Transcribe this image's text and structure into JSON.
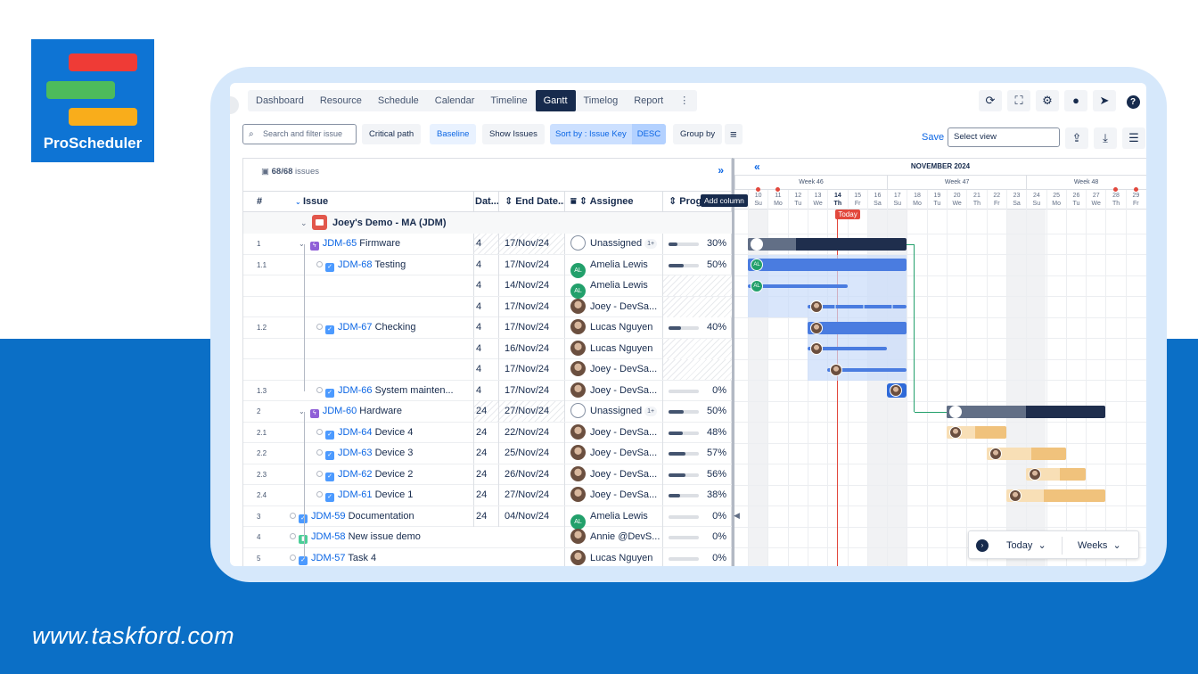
{
  "brand": {
    "logo_text": "ProScheduler",
    "url": "www.taskford.com"
  },
  "nav": {
    "tabs": [
      "Dashboard",
      "Resource",
      "Schedule",
      "Calendar",
      "Timeline",
      "Gantt",
      "Timelog",
      "Report"
    ],
    "active": "Gantt",
    "more": "⋮"
  },
  "top_icons": [
    "refresh-icon",
    "fullscreen-icon",
    "gear-icon",
    "bulb-icon",
    "rocket-icon",
    "help-icon"
  ],
  "toolbar": {
    "search_placeholder": "Search and filter issue",
    "critical_path": "Critical path",
    "baseline": "Baseline",
    "show_issues": "Show Issues",
    "sort_label": "Sort by : Issue Key",
    "sort_dir": "DESC",
    "group_by": "Group by",
    "save": "Save",
    "select_view_placeholder": "Select view"
  },
  "grid": {
    "issues_count": "68/68",
    "issues_label": "issues",
    "headers": {
      "num": "#",
      "issue": "Issue",
      "start": "Dat...",
      "end": "End Date...",
      "assignee": "Assignee",
      "progress": "Progr"
    },
    "add_column_tooltip": "Add column",
    "group_title": "Joey's Demo - MA  (JDM)",
    "rows": [
      {
        "num": "1",
        "indent": 0,
        "type": "epic",
        "key": "JDM-65",
        "title": "Firmware",
        "start": "4",
        "end": "17/Nov/24",
        "assignee": "Unassigned",
        "av": "un",
        "plus": "1+",
        "progress": 30,
        "pct": "30%",
        "chev": true,
        "hatch": true
      },
      {
        "num": "1.1",
        "indent": 1,
        "type": "task",
        "key": "JDM-68",
        "title": "Testing",
        "start": "4",
        "end": "17/Nov/24",
        "assignee": "Amelia Lewis",
        "av": "al",
        "progress": 50,
        "pct": "50%"
      },
      {
        "num": "",
        "indent": 2,
        "type": "",
        "key": "",
        "title": "",
        "start": "4",
        "end": "14/Nov/24",
        "assignee": "Amelia Lewis",
        "av": "al",
        "progress": null,
        "pct": "",
        "hatchprog": true
      },
      {
        "num": "",
        "indent": 2,
        "type": "",
        "key": "",
        "title": "",
        "start": "4",
        "end": "17/Nov/24",
        "assignee": "Joey - DevSa...",
        "av": "ph",
        "progress": null,
        "pct": "",
        "hatchprog": true
      },
      {
        "num": "1.2",
        "indent": 1,
        "type": "task",
        "key": "JDM-67",
        "title": "Checking",
        "start": "4",
        "end": "17/Nov/24",
        "assignee": "Lucas Nguyen",
        "av": "ph",
        "progress": 40,
        "pct": "40%"
      },
      {
        "num": "",
        "indent": 2,
        "type": "",
        "key": "",
        "title": "",
        "start": "4",
        "end": "16/Nov/24",
        "assignee": "Lucas Nguyen",
        "av": "ph",
        "progress": null,
        "pct": "",
        "hatchprog": true
      },
      {
        "num": "",
        "indent": 2,
        "type": "",
        "key": "",
        "title": "",
        "start": "4",
        "end": "17/Nov/24",
        "assignee": "Joey - DevSa...",
        "av": "ph",
        "progress": null,
        "pct": "",
        "hatchprog": true
      },
      {
        "num": "1.3",
        "indent": 1,
        "type": "task",
        "key": "JDM-66",
        "title": "System mainten...",
        "start": "4",
        "end": "17/Nov/24",
        "assignee": "Joey - DevSa...",
        "av": "ph",
        "progress": 0,
        "pct": "0%"
      },
      {
        "num": "2",
        "indent": 0,
        "type": "epic",
        "key": "JDM-60",
        "title": "Hardware",
        "start": "24",
        "end": "27/Nov/24",
        "assignee": "Unassigned",
        "av": "un",
        "plus": "1+",
        "progress": 50,
        "pct": "50%",
        "chev": true,
        "hatch": true
      },
      {
        "num": "2.1",
        "indent": 1,
        "type": "task",
        "key": "JDM-64",
        "title": "Device 4",
        "start": "24",
        "end": "22/Nov/24",
        "assignee": "Joey - DevSa...",
        "av": "ph",
        "progress": 48,
        "pct": "48%"
      },
      {
        "num": "2.2",
        "indent": 1,
        "type": "task",
        "key": "JDM-63",
        "title": "Device 3",
        "start": "24",
        "end": "25/Nov/24",
        "assignee": "Joey - DevSa...",
        "av": "ph",
        "progress": 57,
        "pct": "57%"
      },
      {
        "num": "2.3",
        "indent": 1,
        "type": "task",
        "key": "JDM-62",
        "title": "Device 2",
        "start": "24",
        "end": "26/Nov/24",
        "assignee": "Joey - DevSa...",
        "av": "ph",
        "progress": 56,
        "pct": "56%"
      },
      {
        "num": "2.4",
        "indent": 1,
        "type": "task",
        "key": "JDM-61",
        "title": "Device 1",
        "start": "24",
        "end": "27/Nov/24",
        "assignee": "Joey - DevSa...",
        "av": "ph",
        "progress": 38,
        "pct": "38%"
      },
      {
        "num": "3",
        "indent": 0,
        "type": "task",
        "key": "JDM-59",
        "title": "Documentation",
        "start": "24",
        "end": "04/Nov/24",
        "assignee": "Amelia Lewis",
        "av": "al",
        "progress": 0,
        "pct": "0%"
      },
      {
        "num": "4",
        "indent": 0,
        "type": "story",
        "key": "JDM-58",
        "title": "New issue demo",
        "start": "",
        "end": "",
        "assignee": "Annie @DevS...",
        "av": "ph",
        "progress": 0,
        "pct": "0%"
      },
      {
        "num": "5",
        "indent": 0,
        "type": "task",
        "key": "JDM-57",
        "title": "Task 4",
        "start": "",
        "end": "",
        "assignee": "Lucas Nguyen",
        "av": "ph",
        "progress": 0,
        "pct": "0%"
      }
    ]
  },
  "gantt": {
    "month": "NOVEMBER 2024",
    "nav_left": "«",
    "weeks": [
      {
        "label": "Week 46"
      },
      {
        "label": "Week 47"
      },
      {
        "label": "Week 48"
      }
    ],
    "days": [
      {
        "d": "10",
        "w": "Su",
        "holiday": true
      },
      {
        "d": "11",
        "w": "Mo",
        "holiday": true
      },
      {
        "d": "12",
        "w": "Tu"
      },
      {
        "d": "13",
        "w": "We"
      },
      {
        "d": "14",
        "w": "Th",
        "today": true
      },
      {
        "d": "15",
        "w": "Fr"
      },
      {
        "d": "16",
        "w": "Sa"
      },
      {
        "d": "17",
        "w": "Su"
      },
      {
        "d": "18",
        "w": "Mo"
      },
      {
        "d": "19",
        "w": "Tu"
      },
      {
        "d": "20",
        "w": "We"
      },
      {
        "d": "21",
        "w": "Th"
      },
      {
        "d": "22",
        "w": "Fr"
      },
      {
        "d": "23",
        "w": "Sa"
      },
      {
        "d": "24",
        "w": "Su"
      },
      {
        "d": "25",
        "w": "Mo"
      },
      {
        "d": "26",
        "w": "Tu"
      },
      {
        "d": "27",
        "w": "We"
      },
      {
        "d": "28",
        "w": "Th",
        "holiday": true
      },
      {
        "d": "29",
        "w": "Fr",
        "holiday": true
      }
    ],
    "today_label": "Today",
    "controls": {
      "today": "Today",
      "scale": "Weeks"
    }
  },
  "colors": {
    "accent": "#0c66e4",
    "dark": "#172b4d",
    "today": "#e2483d",
    "brand_blue": "#0b6fc6"
  }
}
